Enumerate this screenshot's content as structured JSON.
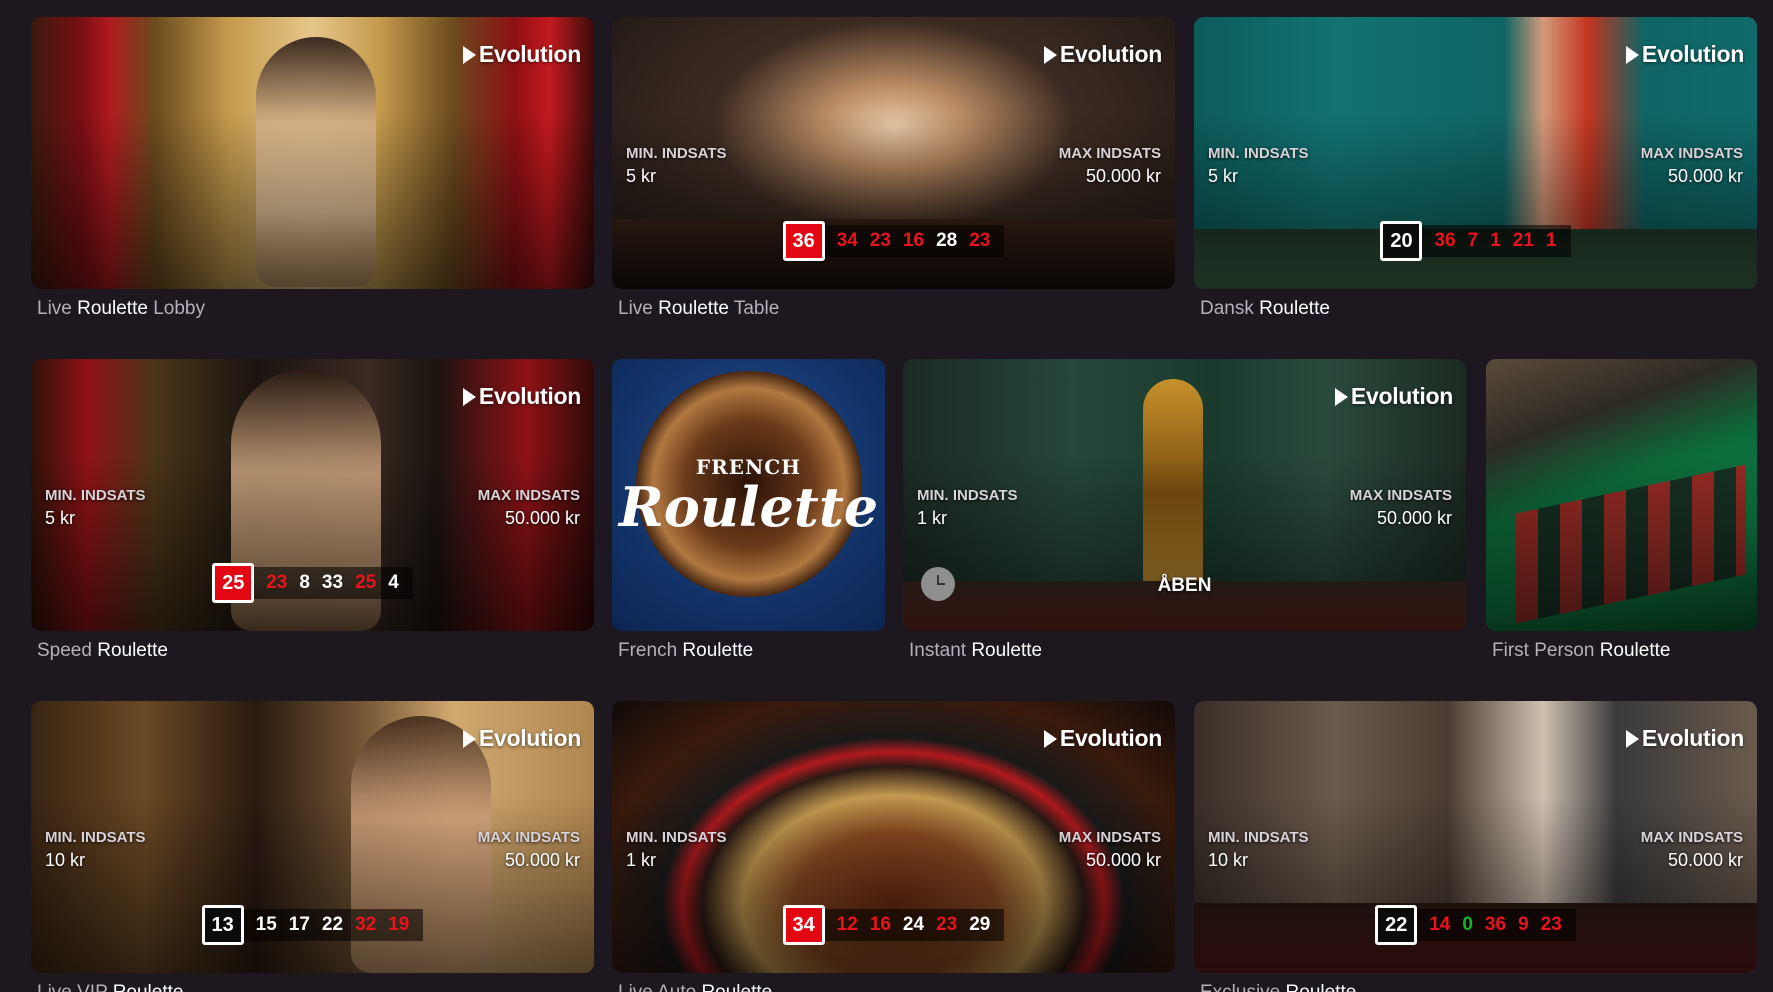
{
  "provider": "Evolution",
  "min_label": "MIN. INDSATS",
  "max_label": "MAX INDSATS",
  "open_label": "ÅBEN",
  "french_logo": {
    "top": "FRENCH",
    "main": "Roulette"
  },
  "games": [
    {
      "title_pre": "Live ",
      "title_hl": "Roulette",
      "title_post": " Lobby",
      "min": "",
      "max": "",
      "results": []
    },
    {
      "title_pre": "Live ",
      "title_hl": "Roulette",
      "title_post": " Table",
      "min": "5  kr",
      "max": "50.000  kr",
      "results": [
        {
          "n": "36",
          "c": "red"
        },
        {
          "n": "34",
          "c": "red"
        },
        {
          "n": "23",
          "c": "red"
        },
        {
          "n": "16",
          "c": "red"
        },
        {
          "n": "28",
          "c": "black"
        },
        {
          "n": "23",
          "c": "red"
        }
      ]
    },
    {
      "title_pre": "Dansk ",
      "title_hl": "Roulette",
      "title_post": "",
      "min": "5  kr",
      "max": "50.000  kr",
      "results": [
        {
          "n": "20",
          "c": "black"
        },
        {
          "n": "36",
          "c": "red"
        },
        {
          "n": "7",
          "c": "red"
        },
        {
          "n": "1",
          "c": "red"
        },
        {
          "n": "21",
          "c": "red"
        },
        {
          "n": "1",
          "c": "red"
        }
      ]
    },
    {
      "title_pre": "Speed ",
      "title_hl": "Roulette",
      "title_post": "",
      "min": "5  kr",
      "max": "50.000  kr",
      "results": [
        {
          "n": "25",
          "c": "red"
        },
        {
          "n": "23",
          "c": "red"
        },
        {
          "n": "8",
          "c": "black"
        },
        {
          "n": "33",
          "c": "black"
        },
        {
          "n": "25",
          "c": "red"
        },
        {
          "n": "4",
          "c": "black"
        }
      ]
    },
    {
      "title_pre": "French ",
      "title_hl": "Roulette",
      "title_post": "",
      "min": "",
      "max": "",
      "results": []
    },
    {
      "title_pre": "Instant ",
      "title_hl": "Roulette",
      "title_post": "",
      "min": "1  kr",
      "max": "50.000  kr",
      "results": []
    },
    {
      "title_pre": "First Person ",
      "title_hl": "Roulette",
      "title_post": "",
      "min": "",
      "max": "",
      "results": []
    },
    {
      "title_pre": "Live VIP ",
      "title_hl": "Roulette",
      "title_post": "",
      "min": "10  kr",
      "max": "50.000  kr",
      "results": [
        {
          "n": "13",
          "c": "black"
        },
        {
          "n": "15",
          "c": "black"
        },
        {
          "n": "17",
          "c": "black"
        },
        {
          "n": "22",
          "c": "black"
        },
        {
          "n": "32",
          "c": "red"
        },
        {
          "n": "19",
          "c": "red"
        }
      ]
    },
    {
      "title_pre": "Live Auto ",
      "title_hl": "Roulette",
      "title_post": "",
      "min": "1  kr",
      "max": "50.000  kr",
      "results": [
        {
          "n": "34",
          "c": "red"
        },
        {
          "n": "12",
          "c": "red"
        },
        {
          "n": "16",
          "c": "red"
        },
        {
          "n": "24",
          "c": "black"
        },
        {
          "n": "23",
          "c": "red"
        },
        {
          "n": "29",
          "c": "black"
        }
      ]
    },
    {
      "title_pre": "Exclusive ",
      "title_hl": "Roulette",
      "title_post": "",
      "min": "10  kr",
      "max": "50.000  kr",
      "results": [
        {
          "n": "22",
          "c": "black"
        },
        {
          "n": "14",
          "c": "red"
        },
        {
          "n": "0",
          "c": "green"
        },
        {
          "n": "36",
          "c": "red"
        },
        {
          "n": "9",
          "c": "red"
        },
        {
          "n": "23",
          "c": "red"
        }
      ]
    }
  ]
}
